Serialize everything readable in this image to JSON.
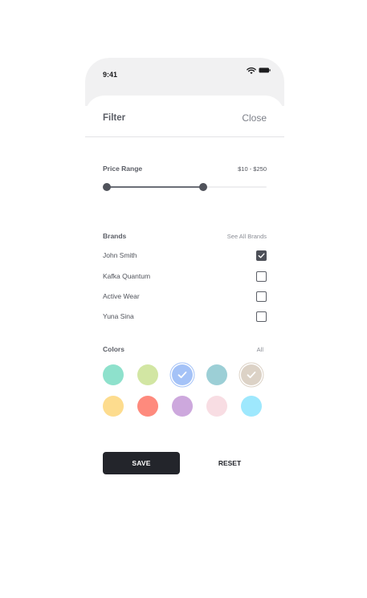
{
  "status_bar": {
    "time": "9:41",
    "wifi_icon": "wifi-icon",
    "battery_icon": "battery-icon"
  },
  "header": {
    "title": "Filter",
    "close_label": "Close"
  },
  "price": {
    "label": "Price Range",
    "value": "$10 - $250",
    "slider_low_fraction": 0.0,
    "slider_high_fraction": 0.62
  },
  "brands": {
    "label": "Brands",
    "link": "See All Brands",
    "items": [
      {
        "label": "John Smith",
        "checked": true
      },
      {
        "label": "Kafka Quantum",
        "checked": false
      },
      {
        "label": "Active Wear",
        "checked": false
      },
      {
        "label": "Yuna Sina",
        "checked": false
      }
    ]
  },
  "colors": {
    "label": "Colors",
    "link": "All",
    "swatches": [
      {
        "color": "#8ee1cc",
        "selected": false
      },
      {
        "color": "#d2e6a3",
        "selected": false
      },
      {
        "color": "#a4c2f7",
        "selected": true
      },
      {
        "color": "#9ccfd6",
        "selected": false
      },
      {
        "color": "#dcd2c6",
        "selected": true
      },
      {
        "color": "#fddc8e",
        "selected": false
      },
      {
        "color": "#fe8a7d",
        "selected": false
      },
      {
        "color": "#cda8dd",
        "selected": false
      },
      {
        "color": "#f8dde3",
        "selected": false
      },
      {
        "color": "#9ee8fd",
        "selected": false
      }
    ]
  },
  "actions": {
    "save_label": "SAVE",
    "reset_label": "RESET"
  }
}
